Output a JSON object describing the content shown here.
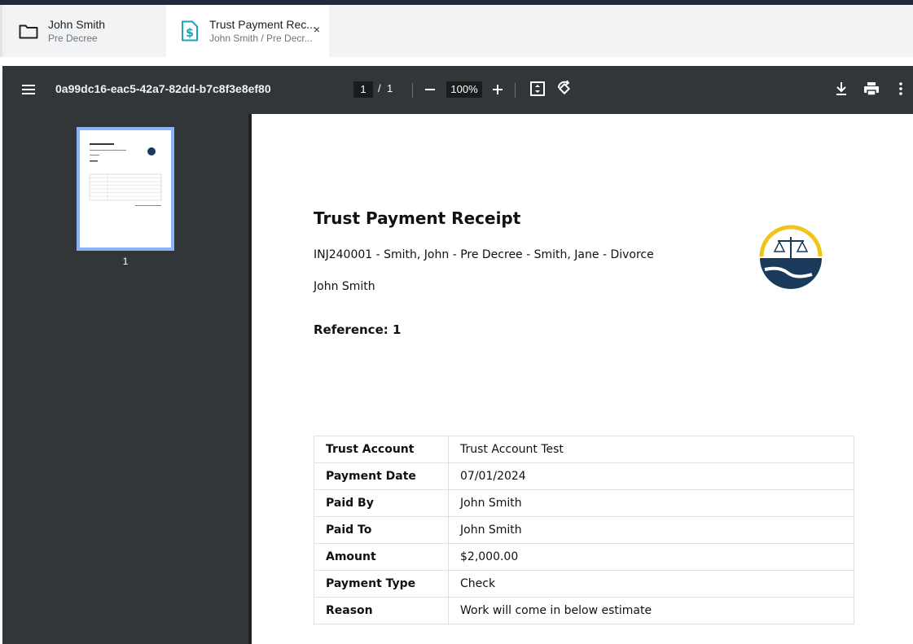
{
  "tabs": [
    {
      "title": "John Smith",
      "subtitle": "Pre Decree",
      "icon": "folder-icon"
    },
    {
      "title": "Trust Payment Rec...",
      "subtitle": "John Smith / Pre Decr...",
      "icon": "dollar-document-icon",
      "close": "×"
    }
  ],
  "toolbar": {
    "document_title": "0a99dc16-eac5-42a7-82dd-b7c8f3e8ef80",
    "current_page": "1",
    "page_separator": "/",
    "total_pages": "1",
    "zoom": "100%"
  },
  "sidebar": {
    "thumbnail_page_number": "1"
  },
  "document": {
    "heading": "Trust Payment Receipt",
    "case_line": "INJ240001 - Smith, John - Pre Decree - Smith, Jane - Divorce",
    "client_name": "John Smith",
    "reference": "Reference: 1",
    "table": [
      {
        "label": "Trust Account",
        "value": "Trust Account Test"
      },
      {
        "label": "Payment Date",
        "value": "07/01/2024"
      },
      {
        "label": "Paid By",
        "value": "John Smith"
      },
      {
        "label": "Paid To",
        "value": "John Smith"
      },
      {
        "label": "Amount",
        "value": "$2,000.00"
      },
      {
        "label": "Payment Type",
        "value": "Check"
      },
      {
        "label": "Reason",
        "value": "Work will come in below estimate"
      }
    ]
  },
  "colors": {
    "toolbar_bg": "#323639",
    "accent_teal": "#1ba3b8",
    "logo_navy": "#1a3a5c",
    "logo_gold": "#f0c419",
    "thumbnail_border": "#8ab4f8"
  }
}
